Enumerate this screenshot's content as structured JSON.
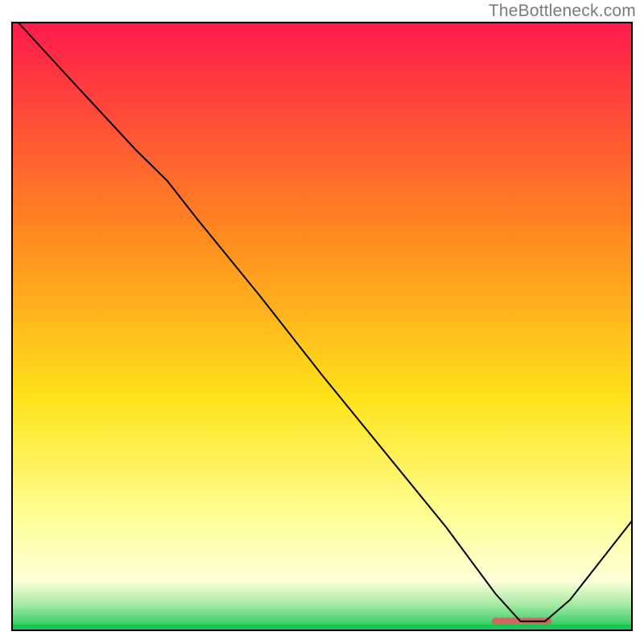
{
  "watermark": "TheBottleneck.com",
  "chart_data": {
    "type": "line",
    "title": "",
    "xlabel": "",
    "ylabel": "",
    "xlim": [
      0,
      100
    ],
    "ylim": [
      0,
      100
    ],
    "grid": false,
    "legend": false,
    "series": [
      {
        "name": "curve",
        "x": [
          1,
          10,
          20,
          25,
          30,
          40,
          50,
          60,
          70,
          78,
          82,
          86,
          90,
          100
        ],
        "y": [
          100,
          90,
          79,
          74,
          67.5,
          55,
          42,
          29.5,
          17,
          6,
          1.5,
          1.5,
          5,
          18
        ],
        "stroke": "#000000",
        "stroke_width": 2
      }
    ],
    "flat_segment": {
      "x_start": 78,
      "x_end": 87,
      "y": 1.5,
      "description": "highlighted flat trough segment",
      "color": "#cc6a62"
    },
    "background_gradient": {
      "top": "#ff1a4b",
      "mid1": "#ff8a1f",
      "mid2": "#ffe31a",
      "mid3": "#ffff9a",
      "bottom_band": "#9fe8a1",
      "bottom_line": "#17c553"
    },
    "frame_color": "#000000"
  }
}
